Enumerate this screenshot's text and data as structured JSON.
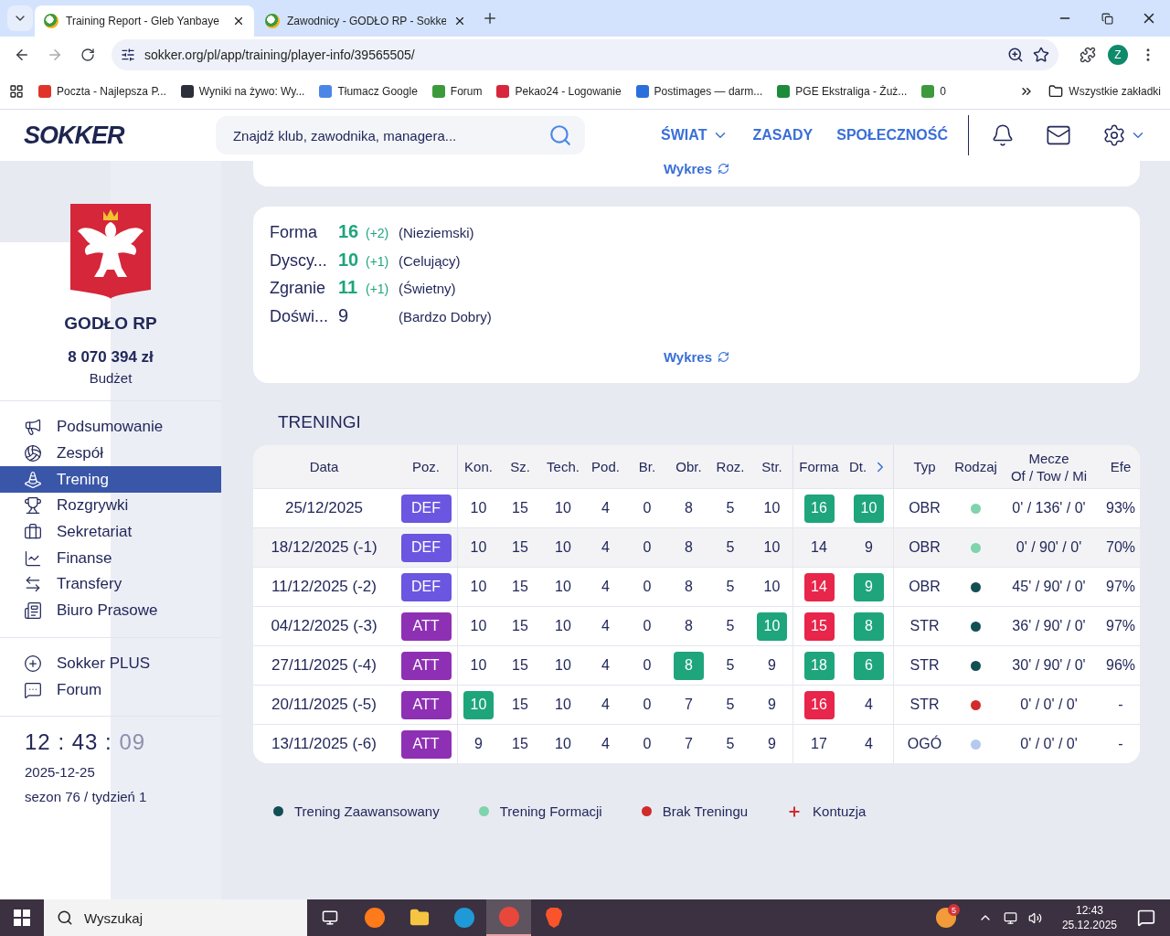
{
  "browser": {
    "tabs": [
      {
        "title": "Training Report - Gleb Yanbaye",
        "selected": true
      },
      {
        "title": "Zawodnicy - GODŁO RP - Sokke",
        "selected": false
      }
    ],
    "url": "sokker.org/pl/app/training/player-info/39565505/",
    "profile_initial": "Z",
    "bookmarks": [
      {
        "label": "Poczta - Najlepsza P...",
        "color": "#e0332b"
      },
      {
        "label": "Wyniki na żywo: Wy...",
        "color": "#2b2f3a"
      },
      {
        "label": "Tłumacz Google",
        "color": "#4a86e8"
      },
      {
        "label": "Forum",
        "color": "#3c9a3c"
      },
      {
        "label": "Pekao24 - Logowanie",
        "color": "#d7263d"
      },
      {
        "label": "Postimages — darm...",
        "color": "#2a6fdb"
      },
      {
        "label": "PGE Ekstraliga - Żuż...",
        "color": "#1e8a3c"
      },
      {
        "label": "0",
        "color": "#3c9a3c"
      }
    ],
    "all_bookmarks": "Wszystkie zakładki"
  },
  "header": {
    "logo": "SOKKER",
    "search_placeholder": "Znajdź klub, zawodnika, managera...",
    "nav": [
      {
        "label": "ŚWIAT",
        "dropdown": true
      },
      {
        "label": "ZASADY",
        "dropdown": false
      },
      {
        "label": "SPOŁECZNOŚĆ",
        "dropdown": false
      }
    ]
  },
  "sidebar": {
    "team": "GODŁO RP",
    "budget": "8 070 394 zł",
    "budget_label": "Budżet",
    "nav": [
      {
        "label": "Podsumowanie",
        "selected": false
      },
      {
        "label": "Zespół",
        "selected": false
      },
      {
        "label": "Trening",
        "selected": true
      },
      {
        "label": "Rozgrywki",
        "selected": false
      },
      {
        "label": "Sekretariat",
        "selected": false
      },
      {
        "label": "Finanse",
        "selected": false
      },
      {
        "label": "Transfery",
        "selected": false
      },
      {
        "label": "Biuro Prasowe",
        "selected": false
      }
    ],
    "extra": [
      {
        "label": "Sokker PLUS"
      },
      {
        "label": "Forum"
      }
    ],
    "clock": {
      "hours": "12",
      "minutes": "43",
      "seconds": "09",
      "separator": ":"
    },
    "date": "2025-12-25",
    "season": "sezon 76 / tydzień 1"
  },
  "top_card": {
    "link": "Wykres"
  },
  "stats": {
    "rows": [
      {
        "label": "Forma",
        "value": "16",
        "change": "(+2)",
        "description": "(Nieziemski)",
        "highlighted": true
      },
      {
        "label": "Dyscy...",
        "value": "10",
        "change": "(+1)",
        "description": "(Celujący)",
        "highlighted": true
      },
      {
        "label": "Zgranie",
        "value": "11",
        "change": "(+1)",
        "description": "(Świetny)",
        "highlighted": true
      },
      {
        "label": "Doświ...",
        "value": "9",
        "description": "(Bardzo Dobry)",
        "highlighted": false
      }
    ],
    "link": "Wykres"
  },
  "trainings": {
    "title": "TRENINGI",
    "columns": [
      {
        "label": "Data"
      },
      {
        "label": "Poz."
      },
      {
        "label": "Kon."
      },
      {
        "label": "Sz."
      },
      {
        "label": "Tech."
      },
      {
        "label": "Pod."
      },
      {
        "label": "Br."
      },
      {
        "label": "Obr."
      },
      {
        "label": "Roz."
      },
      {
        "label": "Str."
      },
      {
        "label": "Forma"
      },
      {
        "label": "Dt.",
        "next": true
      },
      {
        "label": "Typ"
      },
      {
        "label": "Rodzaj"
      },
      {
        "label": "Mecze",
        "sublabel": "Of / Tow / Mi"
      },
      {
        "label": "Efe"
      }
    ],
    "rows": [
      {
        "date": "25/12/2025",
        "position": {
          "label": "DEF",
          "color": "#6a56e0"
        },
        "stats": [
          {
            "value": "10"
          },
          {
            "value": "15"
          },
          {
            "value": "10"
          },
          {
            "value": "4"
          },
          {
            "value": "0"
          },
          {
            "value": "8"
          },
          {
            "value": "5"
          },
          {
            "value": "10"
          },
          {
            "value": "16",
            "color": "#1ea57c"
          },
          {
            "value": "10",
            "color": "#1ea57c"
          }
        ],
        "type": "OBR",
        "training_kind": {
          "color": "#7fd3ad"
        },
        "minutes": "0' / 136' / 0'",
        "efficiency": "93%",
        "selected": false
      },
      {
        "date": "18/12/2025 (-1)",
        "position": {
          "label": "DEF",
          "color": "#6a56e0"
        },
        "stats": [
          {
            "value": "10"
          },
          {
            "value": "15"
          },
          {
            "value": "10"
          },
          {
            "value": "4"
          },
          {
            "value": "0"
          },
          {
            "value": "8"
          },
          {
            "value": "5"
          },
          {
            "value": "10"
          },
          {
            "value": "14"
          },
          {
            "value": "9"
          }
        ],
        "type": "OBR",
        "training_kind": {
          "color": "#7fd3ad"
        },
        "minutes": "0' / 90' / 0'",
        "efficiency": "70%",
        "selected": true
      },
      {
        "date": "11/12/2025 (-2)",
        "position": {
          "label": "DEF",
          "color": "#6a56e0"
        },
        "stats": [
          {
            "value": "10"
          },
          {
            "value": "15"
          },
          {
            "value": "10"
          },
          {
            "value": "4"
          },
          {
            "value": "0"
          },
          {
            "value": "8"
          },
          {
            "value": "5"
          },
          {
            "value": "10"
          },
          {
            "value": "14",
            "color": "#e8254a"
          },
          {
            "value": "9",
            "color": "#1ea57c"
          }
        ],
        "type": "OBR",
        "training_kind": {
          "color": "#124f55"
        },
        "minutes": "45' / 90' / 0'",
        "efficiency": "97%",
        "selected": false
      },
      {
        "date": "04/12/2025 (-3)",
        "position": {
          "label": "ATT",
          "color": "#8e30b4"
        },
        "stats": [
          {
            "value": "10"
          },
          {
            "value": "15"
          },
          {
            "value": "10"
          },
          {
            "value": "4"
          },
          {
            "value": "0"
          },
          {
            "value": "8"
          },
          {
            "value": "5"
          },
          {
            "value": "10",
            "color": "#1ea57c"
          },
          {
            "value": "15",
            "color": "#e8254a"
          },
          {
            "value": "8",
            "color": "#1ea57c"
          }
        ],
        "type": "STR",
        "training_kind": {
          "color": "#124f55"
        },
        "minutes": "36' / 90' / 0'",
        "efficiency": "97%",
        "selected": false
      },
      {
        "date": "27/11/2025 (-4)",
        "position": {
          "label": "ATT",
          "color": "#8e30b4"
        },
        "stats": [
          {
            "value": "10"
          },
          {
            "value": "15"
          },
          {
            "value": "10"
          },
          {
            "value": "4"
          },
          {
            "value": "0"
          },
          {
            "value": "8",
            "color": "#1ea57c"
          },
          {
            "value": "5"
          },
          {
            "value": "9"
          },
          {
            "value": "18",
            "color": "#1ea57c"
          },
          {
            "value": "6",
            "color": "#1ea57c"
          }
        ],
        "type": "STR",
        "training_kind": {
          "color": "#124f55"
        },
        "minutes": "30' / 90' / 0'",
        "efficiency": "96%",
        "selected": false
      },
      {
        "date": "20/11/2025 (-5)",
        "position": {
          "label": "ATT",
          "color": "#8e30b4"
        },
        "stats": [
          {
            "value": "10",
            "color": "#1ea57c"
          },
          {
            "value": "15"
          },
          {
            "value": "10"
          },
          {
            "value": "4"
          },
          {
            "value": "0"
          },
          {
            "value": "7"
          },
          {
            "value": "5"
          },
          {
            "value": "9"
          },
          {
            "value": "16",
            "color": "#e8254a"
          },
          {
            "value": "4"
          }
        ],
        "type": "STR",
        "training_kind": {
          "color": "#d12b2b"
        },
        "minutes": "0' / 0' / 0'",
        "efficiency": "-",
        "selected": false
      },
      {
        "date": "13/11/2025 (-6)",
        "position": {
          "label": "ATT",
          "color": "#8e30b4"
        },
        "stats": [
          {
            "value": "9"
          },
          {
            "value": "15"
          },
          {
            "value": "10"
          },
          {
            "value": "4"
          },
          {
            "value": "0"
          },
          {
            "value": "7"
          },
          {
            "value": "5"
          },
          {
            "value": "9"
          },
          {
            "value": "17"
          },
          {
            "value": "4"
          }
        ],
        "type": "OGÓ",
        "training_kind": {
          "color": "#b5c9ee"
        },
        "minutes": "0' / 0' / 0'",
        "efficiency": "-",
        "selected": false
      }
    ]
  },
  "legend": [
    {
      "label": "Trening Zaawansowany",
      "kind": "dot",
      "color": "#124f55"
    },
    {
      "label": "Trening Formacji",
      "kind": "dot",
      "color": "#7fd3ad"
    },
    {
      "label": "Brak Treningu",
      "kind": "dot",
      "color": "#d12b2b"
    },
    {
      "label": "Kontuzja",
      "kind": "plus",
      "color": "#d12b2b"
    }
  ],
  "taskbar": {
    "search_placeholder": "Wyszukaj",
    "weather_badge": "5",
    "time": "12:43",
    "date": "25.12.2025"
  }
}
